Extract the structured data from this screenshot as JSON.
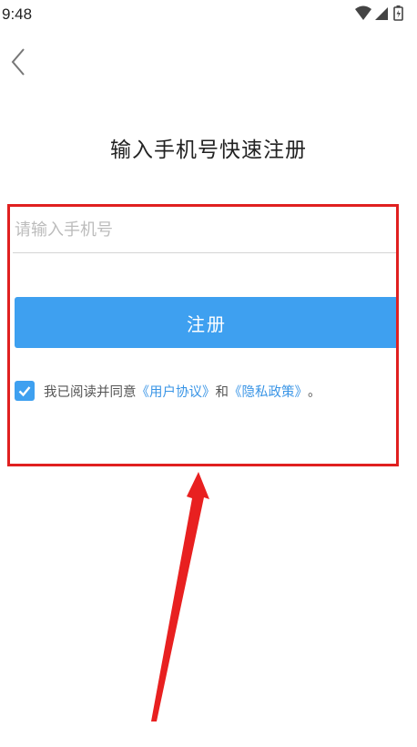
{
  "status_bar": {
    "time": "9:48",
    "icons": [
      "wifi-icon",
      "signal-icon",
      "battery-icon"
    ]
  },
  "header": {
    "back_icon": "chevron-left-icon"
  },
  "page": {
    "title": "输入手机号快速注册"
  },
  "form": {
    "phone_placeholder": "请输入手机号",
    "phone_value": "",
    "register_label": "注册",
    "agreement": {
      "checked": true,
      "prefix": "我已阅读并同意",
      "user_agreement": "《用户协议》",
      "conjunction": "和",
      "privacy_policy": "《隐私政策》",
      "suffix": "。"
    }
  },
  "colors": {
    "accent": "#3ea0f0",
    "link": "#3a95e6",
    "annotation": "#e02020"
  }
}
